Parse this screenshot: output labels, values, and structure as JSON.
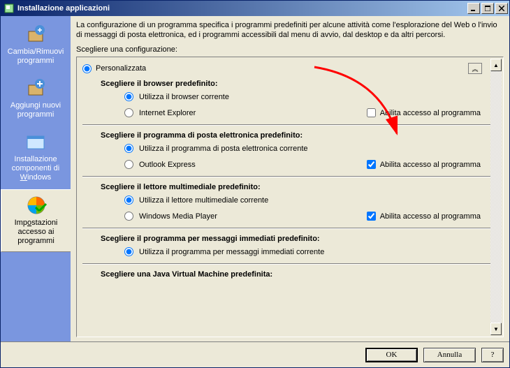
{
  "window": {
    "title": "Installazione applicazioni"
  },
  "sidebar": {
    "items": [
      {
        "label": "Cambia/Rimuovi programmi"
      },
      {
        "label": "Aggiungi nuovi programmi"
      },
      {
        "label": "Installazione componenti di Windows"
      },
      {
        "label": "Impostazioni accesso ai programmi"
      }
    ]
  },
  "main": {
    "intro": "La configurazione di un programma specifica i programmi predefiniti per alcune attività come l'esplorazione del Web o l'invio di messaggi di posta elettronica, ed i programmi accessibili dal menu di avvio, dal desktop e da altri percorsi.",
    "choose": "Scegliere una configurazione:",
    "config_label": "Personalizzata",
    "collapse_glyph": "︽",
    "access_label": "Abilita accesso al programma",
    "sections": {
      "browser": {
        "title": "Scegliere il browser predefinito:",
        "opt1": "Utilizza il browser corrente",
        "opt2": "Internet Explorer"
      },
      "email": {
        "title": "Scegliere il programma di posta elettronica predefinito:",
        "opt1": "Utilizza il programma di posta elettronica corrente",
        "opt2": "Outlook Express"
      },
      "media": {
        "title": "Scegliere il lettore multimediale predefinito:",
        "opt1": "Utilizza il lettore multimediale corrente",
        "opt2": "Windows Media Player"
      },
      "im": {
        "title": "Scegliere il programma per messaggi immediati predefinito:",
        "opt1": "Utilizza il programma per messaggi immediati corrente"
      },
      "jvm": {
        "title": "Scegliere una Java Virtual Machine predefinita:"
      }
    }
  },
  "footer": {
    "ok": "OK",
    "cancel": "Annulla",
    "help": "?"
  }
}
